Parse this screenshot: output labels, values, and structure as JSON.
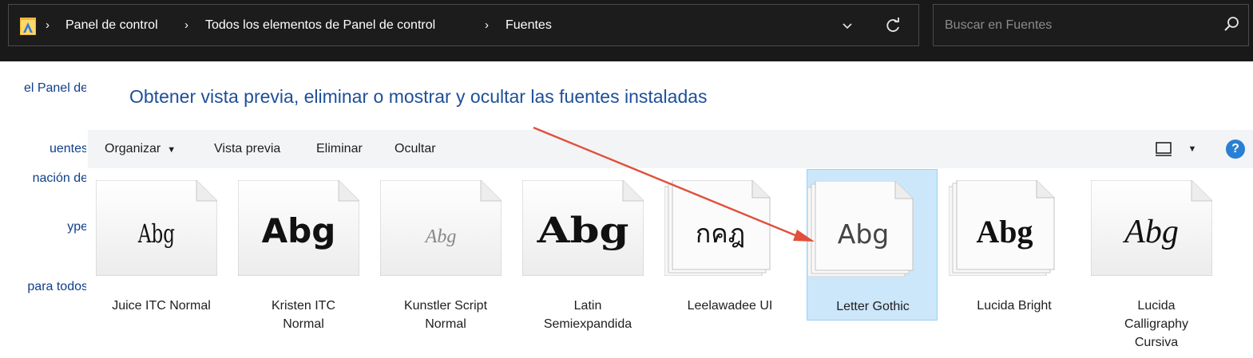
{
  "addressbar": {
    "crumbs": [
      "Panel de control",
      "Todos los elementos de Panel de control",
      "Fuentes"
    ],
    "separator": "›"
  },
  "search": {
    "placeholder": "Buscar en Fuentes"
  },
  "leftnav": {
    "items": [
      "el Panel de",
      "uentes",
      "nación de",
      "ype",
      "para todos"
    ]
  },
  "heading": "Obtener vista previa, eliminar o mostrar y ocultar las fuentes instaladas",
  "toolbar": {
    "organize": "Organizar",
    "caret": "▼",
    "preview": "Vista previa",
    "delete": "Eliminar",
    "hide": "Ocultar",
    "help": "?"
  },
  "fonts": [
    {
      "name": "Juice ITC Normal",
      "line2": "",
      "line3": "",
      "sample": "Abg",
      "selected": false,
      "stack": false
    },
    {
      "name": "Kristen ITC",
      "line2": "Normal",
      "line3": "",
      "sample": "Abg",
      "selected": false,
      "stack": false
    },
    {
      "name": "Kunstler Script",
      "line2": "Normal",
      "line3": "",
      "sample": "Abg",
      "selected": false,
      "stack": false
    },
    {
      "name": "Latin",
      "line2": "Semiexpandida",
      "line3": "",
      "sample": "Abg",
      "selected": false,
      "stack": false
    },
    {
      "name": "Leelawadee UI",
      "line2": "",
      "line3": "",
      "sample": "กคฎ",
      "selected": false,
      "stack": true
    },
    {
      "name": "Letter Gothic",
      "line2": "",
      "line3": "",
      "sample": "Abg",
      "selected": true,
      "stack": true
    },
    {
      "name": "Lucida Bright",
      "line2": "",
      "line3": "",
      "sample": "Abg",
      "selected": false,
      "stack": true
    },
    {
      "name": "Lucida",
      "line2": "Calligraphy",
      "line3": "Cursiva",
      "sample": "Abg",
      "selected": false,
      "stack": false
    }
  ],
  "colors": {
    "accent_arrow": "#e0503a",
    "selection": "#cce7fa",
    "link": "#1e4f9a"
  }
}
